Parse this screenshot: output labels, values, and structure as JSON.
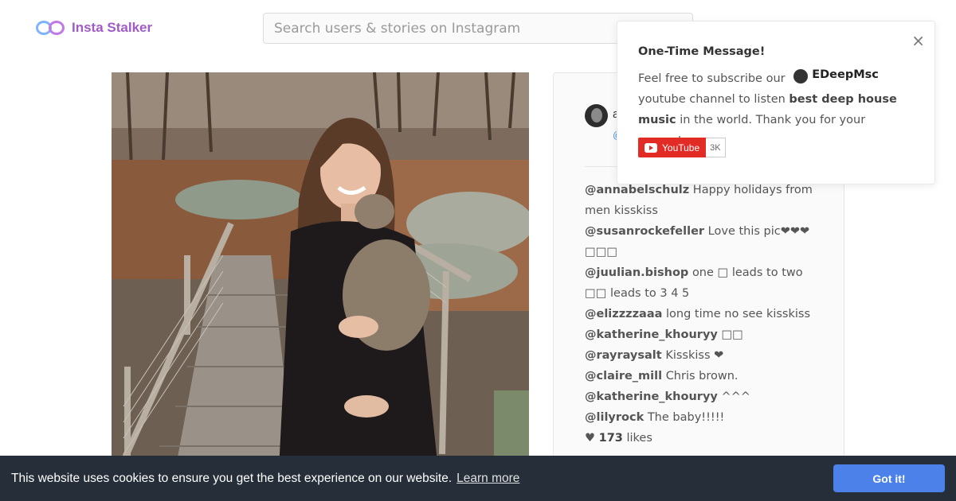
{
  "header": {
    "logo_text": "Insta Stalker",
    "search_placeholder": "Search users & stories on Instagram"
  },
  "post": {
    "comments": [
      {
        "user": "@annabelschulz",
        "text": "Happy holidays from men kisskiss"
      },
      {
        "user": "@susanrockefeller",
        "text": "Love this pic❤❤❤□□□"
      },
      {
        "user": "@juulian.bishop",
        "text": "one □ leads to two □□ leads to 3 4 5"
      },
      {
        "user": "@elizzzzaaa",
        "text": "long time no see kisskiss"
      },
      {
        "user": "@katherine_khouryy",
        "text": "□□"
      },
      {
        "user": "@rayraysalt",
        "text": "Kisskiss ❤"
      },
      {
        "user": "@claire_mill",
        "text": "Chris brown."
      },
      {
        "user": "@katherine_khouryy",
        "text": "^^^"
      },
      {
        "user": "@lilyrock",
        "text": "The baby!!!!!"
      }
    ],
    "likes_count": "173",
    "likes_label": "likes"
  },
  "popup": {
    "title": "One-Time Message!",
    "text_before": "Feel free to subscribe our",
    "channel_name": "EDeepMsc",
    "text_after": "youtube channel to listen",
    "emphasis": "best deep house music",
    "text_end": "in the world. Thank you for your support.",
    "youtube_label": "YouTube",
    "subscriber_count": "3K",
    "close_symbol": "×"
  },
  "cookie": {
    "message": "This website uses cookies to ensure you get the best experience on our website.",
    "learn_more": "Learn more",
    "button": "Got it!"
  },
  "colors": {
    "brand": "#a05bc6",
    "cookie_bar": "#252e39",
    "cookie_button": "#4b81e8",
    "youtube_red": "#e22b25"
  }
}
